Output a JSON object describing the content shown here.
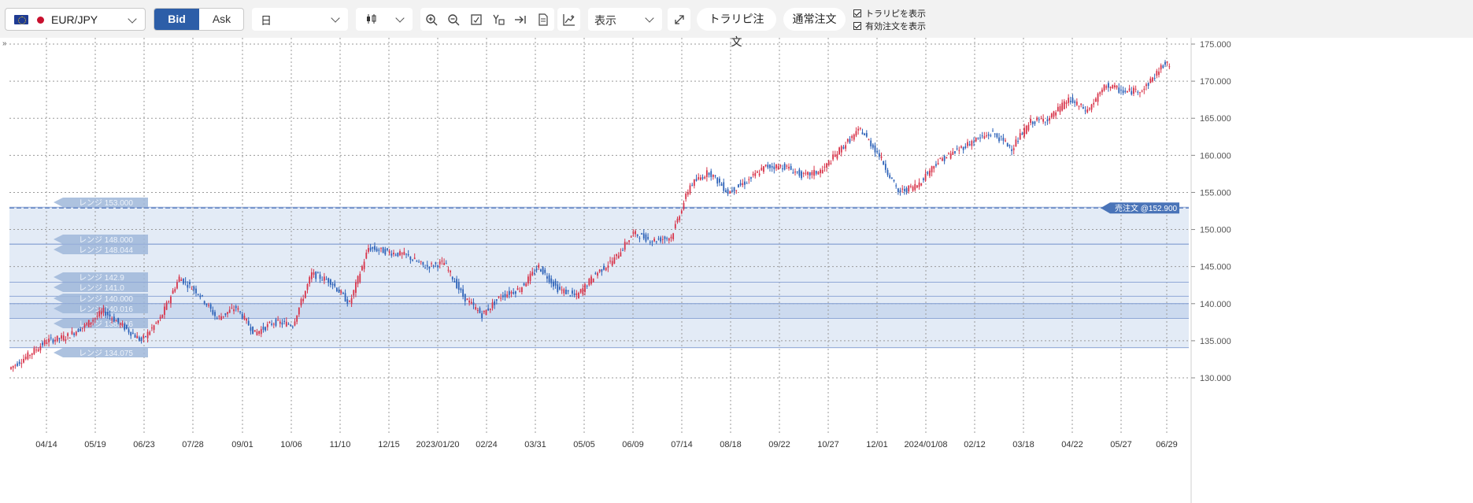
{
  "toolbar": {
    "symbol": "EUR/JPY",
    "bid_label": "Bid",
    "ask_label": "Ask",
    "period": "日",
    "display_label": "表示",
    "tsurupi_label": "トラリピ注文",
    "normal_order_label": "通常注文",
    "show_tsurupi_label": "トラリピを表示",
    "show_orders_label": "有効注文を表示"
  },
  "chart_data": {
    "type": "candlestick",
    "y_axis": {
      "min": 130.0,
      "max": 175.0,
      "ticks": [
        "175.000",
        "170.000",
        "165.000",
        "160.000",
        "155.000",
        "150.000",
        "145.000",
        "140.000",
        "135.000",
        "130.000"
      ]
    },
    "x_labels": [
      "04/14",
      "05/19",
      "06/23",
      "07/28",
      "09/01",
      "10/06",
      "11/10",
      "12/15",
      "2023/01/20",
      "02/24",
      "03/31",
      "05/05",
      "06/09",
      "07/14",
      "08/18",
      "09/22",
      "10/27",
      "12/01",
      "2024/01/08",
      "02/12",
      "03/18",
      "04/22",
      "05/27",
      "06/29"
    ],
    "trend": [
      [
        0,
        131.2
      ],
      [
        3,
        133.0
      ],
      [
        6,
        135.0
      ],
      [
        9,
        135.5
      ],
      [
        12,
        137.0
      ],
      [
        15,
        139.0
      ],
      [
        18,
        137.0
      ],
      [
        21,
        135.0
      ],
      [
        24,
        138.0
      ],
      [
        27,
        143.5
      ],
      [
        30,
        141.5
      ],
      [
        33,
        138.0
      ],
      [
        36,
        139.5
      ],
      [
        39,
        136.0
      ],
      [
        42,
        137.5
      ],
      [
        45,
        137.2
      ],
      [
        48,
        144.0
      ],
      [
        51,
        143.0
      ],
      [
        54,
        140.0
      ],
      [
        57,
        147.5
      ],
      [
        60,
        147.0
      ],
      [
        63,
        146.5
      ],
      [
        66,
        145.0
      ],
      [
        69,
        145.5
      ],
      [
        72,
        141.0
      ],
      [
        75,
        138.5
      ],
      [
        78,
        141.0
      ],
      [
        81,
        142.0
      ],
      [
        84,
        145.0
      ],
      [
        87,
        142.0
      ],
      [
        90,
        141.0
      ],
      [
        93,
        144.0
      ],
      [
        96,
        146.0
      ],
      [
        99,
        149.5
      ],
      [
        102,
        148.5
      ],
      [
        105,
        149.0
      ],
      [
        108,
        156.0
      ],
      [
        111,
        157.8
      ],
      [
        114,
        155.0
      ],
      [
        117,
        156.5
      ],
      [
        120,
        158.5
      ],
      [
        123,
        158.5
      ],
      [
        126,
        157.2
      ],
      [
        129,
        158.0
      ],
      [
        132,
        161.0
      ],
      [
        135,
        163.5
      ],
      [
        138,
        160.0
      ],
      [
        141,
        155.0
      ],
      [
        144,
        156.0
      ],
      [
        147,
        159.0
      ],
      [
        150,
        160.5
      ],
      [
        153,
        162.0
      ],
      [
        156,
        163.0
      ],
      [
        159,
        161.0
      ],
      [
        162,
        164.5
      ],
      [
        165,
        165.0
      ],
      [
        168,
        167.5
      ],
      [
        171,
        166.0
      ],
      [
        174,
        169.5
      ],
      [
        177,
        168.5
      ],
      [
        180,
        169.0
      ],
      [
        183,
        172.2
      ]
    ],
    "ranges": [
      {
        "label": "レンジ 153.000",
        "value": 153.0
      },
      {
        "label": "レンジ 148.000",
        "value": 148.0
      },
      {
        "label": "レンジ 148.044",
        "value": 148.044
      },
      {
        "label": "レンジ 142.9",
        "value": 142.9
      },
      {
        "label": "レンジ 141.0",
        "value": 141.0
      },
      {
        "label": "レンジ 140.000",
        "value": 140.0
      },
      {
        "label": "レンジ 140.016",
        "value": 140.016
      },
      {
        "label": "レンジ 138.016",
        "value": 138.016
      },
      {
        "label": "レンジ 134.075",
        "value": 134.075
      }
    ],
    "shaded_band": {
      "from": 134.0,
      "to": 153.0
    },
    "order_line": {
      "label": "売注文 @152.900",
      "value": 152.9
    },
    "colors": {
      "up": "#d8344a",
      "down": "#2d62b8",
      "band": "#e3ebf6",
      "band_dark": "#ccdaef",
      "range_tag": "#9fb7d9",
      "order_tag": "#4a74b8"
    }
  }
}
